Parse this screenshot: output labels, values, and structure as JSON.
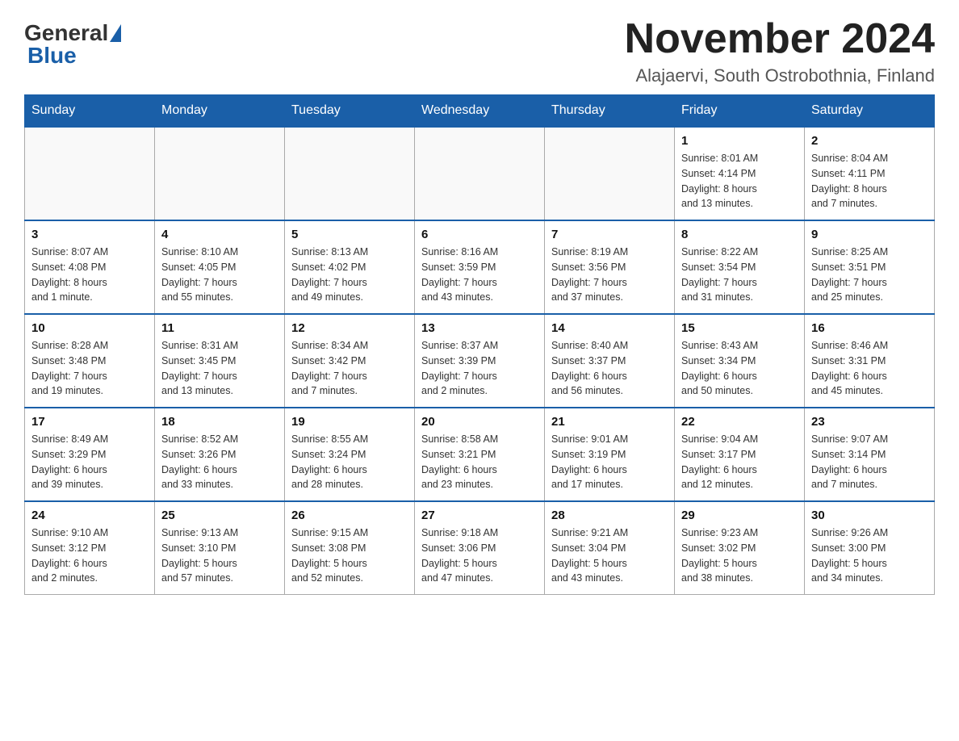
{
  "header": {
    "title": "November 2024",
    "subtitle": "Alajaervi, South Ostrobothnia, Finland"
  },
  "logo": {
    "general": "General",
    "blue": "Blue"
  },
  "days_of_week": [
    "Sunday",
    "Monday",
    "Tuesday",
    "Wednesday",
    "Thursday",
    "Friday",
    "Saturday"
  ],
  "weeks": [
    [
      {
        "day": "",
        "info": ""
      },
      {
        "day": "",
        "info": ""
      },
      {
        "day": "",
        "info": ""
      },
      {
        "day": "",
        "info": ""
      },
      {
        "day": "",
        "info": ""
      },
      {
        "day": "1",
        "info": "Sunrise: 8:01 AM\nSunset: 4:14 PM\nDaylight: 8 hours\nand 13 minutes."
      },
      {
        "day": "2",
        "info": "Sunrise: 8:04 AM\nSunset: 4:11 PM\nDaylight: 8 hours\nand 7 minutes."
      }
    ],
    [
      {
        "day": "3",
        "info": "Sunrise: 8:07 AM\nSunset: 4:08 PM\nDaylight: 8 hours\nand 1 minute."
      },
      {
        "day": "4",
        "info": "Sunrise: 8:10 AM\nSunset: 4:05 PM\nDaylight: 7 hours\nand 55 minutes."
      },
      {
        "day": "5",
        "info": "Sunrise: 8:13 AM\nSunset: 4:02 PM\nDaylight: 7 hours\nand 49 minutes."
      },
      {
        "day": "6",
        "info": "Sunrise: 8:16 AM\nSunset: 3:59 PM\nDaylight: 7 hours\nand 43 minutes."
      },
      {
        "day": "7",
        "info": "Sunrise: 8:19 AM\nSunset: 3:56 PM\nDaylight: 7 hours\nand 37 minutes."
      },
      {
        "day": "8",
        "info": "Sunrise: 8:22 AM\nSunset: 3:54 PM\nDaylight: 7 hours\nand 31 minutes."
      },
      {
        "day": "9",
        "info": "Sunrise: 8:25 AM\nSunset: 3:51 PM\nDaylight: 7 hours\nand 25 minutes."
      }
    ],
    [
      {
        "day": "10",
        "info": "Sunrise: 8:28 AM\nSunset: 3:48 PM\nDaylight: 7 hours\nand 19 minutes."
      },
      {
        "day": "11",
        "info": "Sunrise: 8:31 AM\nSunset: 3:45 PM\nDaylight: 7 hours\nand 13 minutes."
      },
      {
        "day": "12",
        "info": "Sunrise: 8:34 AM\nSunset: 3:42 PM\nDaylight: 7 hours\nand 7 minutes."
      },
      {
        "day": "13",
        "info": "Sunrise: 8:37 AM\nSunset: 3:39 PM\nDaylight: 7 hours\nand 2 minutes."
      },
      {
        "day": "14",
        "info": "Sunrise: 8:40 AM\nSunset: 3:37 PM\nDaylight: 6 hours\nand 56 minutes."
      },
      {
        "day": "15",
        "info": "Sunrise: 8:43 AM\nSunset: 3:34 PM\nDaylight: 6 hours\nand 50 minutes."
      },
      {
        "day": "16",
        "info": "Sunrise: 8:46 AM\nSunset: 3:31 PM\nDaylight: 6 hours\nand 45 minutes."
      }
    ],
    [
      {
        "day": "17",
        "info": "Sunrise: 8:49 AM\nSunset: 3:29 PM\nDaylight: 6 hours\nand 39 minutes."
      },
      {
        "day": "18",
        "info": "Sunrise: 8:52 AM\nSunset: 3:26 PM\nDaylight: 6 hours\nand 33 minutes."
      },
      {
        "day": "19",
        "info": "Sunrise: 8:55 AM\nSunset: 3:24 PM\nDaylight: 6 hours\nand 28 minutes."
      },
      {
        "day": "20",
        "info": "Sunrise: 8:58 AM\nSunset: 3:21 PM\nDaylight: 6 hours\nand 23 minutes."
      },
      {
        "day": "21",
        "info": "Sunrise: 9:01 AM\nSunset: 3:19 PM\nDaylight: 6 hours\nand 17 minutes."
      },
      {
        "day": "22",
        "info": "Sunrise: 9:04 AM\nSunset: 3:17 PM\nDaylight: 6 hours\nand 12 minutes."
      },
      {
        "day": "23",
        "info": "Sunrise: 9:07 AM\nSunset: 3:14 PM\nDaylight: 6 hours\nand 7 minutes."
      }
    ],
    [
      {
        "day": "24",
        "info": "Sunrise: 9:10 AM\nSunset: 3:12 PM\nDaylight: 6 hours\nand 2 minutes."
      },
      {
        "day": "25",
        "info": "Sunrise: 9:13 AM\nSunset: 3:10 PM\nDaylight: 5 hours\nand 57 minutes."
      },
      {
        "day": "26",
        "info": "Sunrise: 9:15 AM\nSunset: 3:08 PM\nDaylight: 5 hours\nand 52 minutes."
      },
      {
        "day": "27",
        "info": "Sunrise: 9:18 AM\nSunset: 3:06 PM\nDaylight: 5 hours\nand 47 minutes."
      },
      {
        "day": "28",
        "info": "Sunrise: 9:21 AM\nSunset: 3:04 PM\nDaylight: 5 hours\nand 43 minutes."
      },
      {
        "day": "29",
        "info": "Sunrise: 9:23 AM\nSunset: 3:02 PM\nDaylight: 5 hours\nand 38 minutes."
      },
      {
        "day": "30",
        "info": "Sunrise: 9:26 AM\nSunset: 3:00 PM\nDaylight: 5 hours\nand 34 minutes."
      }
    ]
  ]
}
